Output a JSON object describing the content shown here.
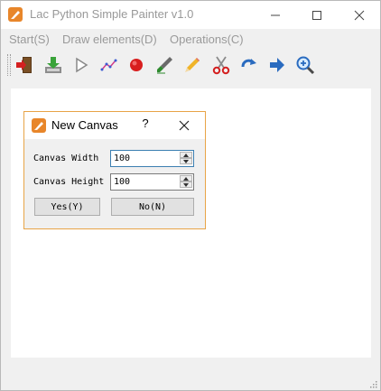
{
  "window": {
    "title": "Lac Python Simple Painter v1.0"
  },
  "menu": {
    "items": [
      {
        "label": "Start(S)"
      },
      {
        "label": "Draw elements(D)"
      },
      {
        "label": "Operations(C)"
      }
    ]
  },
  "toolbar": {
    "icons": [
      "exit-icon",
      "save-icon",
      "play-icon",
      "line-chart-icon",
      "record-icon",
      "brush-icon",
      "pencil-icon",
      "scissors-icon",
      "redo-icon",
      "forward-arrow-icon",
      "zoom-in-icon"
    ]
  },
  "dialog": {
    "title": "New Canvas",
    "help_label": "?",
    "width_label": "Canvas Width",
    "width_value": "100",
    "height_label": "Canvas Height",
    "height_value": "100",
    "yes_label": "Yes(Y)",
    "no_label": "No(N)"
  },
  "colors": {
    "accent": "#e8862a",
    "dialog_border": "#e8a447",
    "menu_text": "#9a9a9a"
  }
}
